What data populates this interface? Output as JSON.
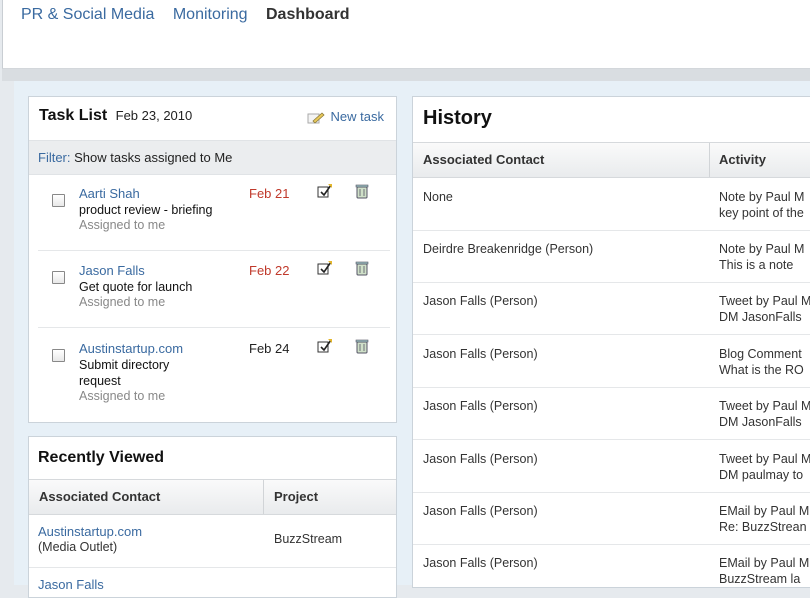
{
  "nav": {
    "items": [
      "PR & Social Media",
      "Monitoring",
      "Dashboard"
    ]
  },
  "task_list": {
    "title": "Task List",
    "date": "Feb 23, 2010",
    "new_task": "New task",
    "filter_label": "Filter:",
    "filter_value": "Show tasks assigned to Me",
    "tasks": [
      {
        "name": "Aarti Shah",
        "desc": "product review - briefing",
        "assigned": "Assigned to me",
        "due": "Feb 21"
      },
      {
        "name": "Jason Falls",
        "desc": "Get quote for launch",
        "assigned": "Assigned to me",
        "due": "Feb 22"
      },
      {
        "name": "Austinstartup.com",
        "desc": "Submit directory request",
        "assigned": "Assigned to me",
        "due": "Feb 24"
      }
    ]
  },
  "recently_viewed": {
    "title": "Recently Viewed",
    "columns": [
      "Associated Contact",
      "Project"
    ],
    "rows": [
      {
        "contact": "Austinstartup.com",
        "type": "(Media Outlet)",
        "project": "BuzzStream"
      },
      {
        "contact": "Jason Falls"
      }
    ]
  },
  "history": {
    "title": "History",
    "columns": [
      "Associated Contact",
      "Activity"
    ],
    "rows": [
      {
        "contact": "None",
        "act1": "Note by Paul M",
        "act2": "key point of the"
      },
      {
        "contact": "Deirdre Breakenridge (Person)",
        "act1": "Note by Paul M",
        "act2": "This is a note"
      },
      {
        "contact": "Jason Falls (Person)",
        "act1": "Tweet by Paul M",
        "act2": "DM JasonFalls"
      },
      {
        "contact": "Jason Falls (Person)",
        "act1": "Blog Comment",
        "act2": "What is the RO"
      },
      {
        "contact": "Jason Falls (Person)",
        "act1": "Tweet by Paul M",
        "act2": "DM JasonFalls"
      },
      {
        "contact": "Jason Falls (Person)",
        "act1": "Tweet by Paul M",
        "act2": "DM paulmay to"
      },
      {
        "contact": "Jason Falls (Person)",
        "act1": "EMail by Paul M",
        "act2": "Re: BuzzStrean"
      },
      {
        "contact": "Jason Falls (Person)",
        "act1": "EMail by Paul M",
        "act2": "BuzzStream la"
      }
    ]
  },
  "colors": {
    "link": "#3a6aa0",
    "overdue": "#c0392b",
    "panel_bg": "#e7f0f7"
  }
}
